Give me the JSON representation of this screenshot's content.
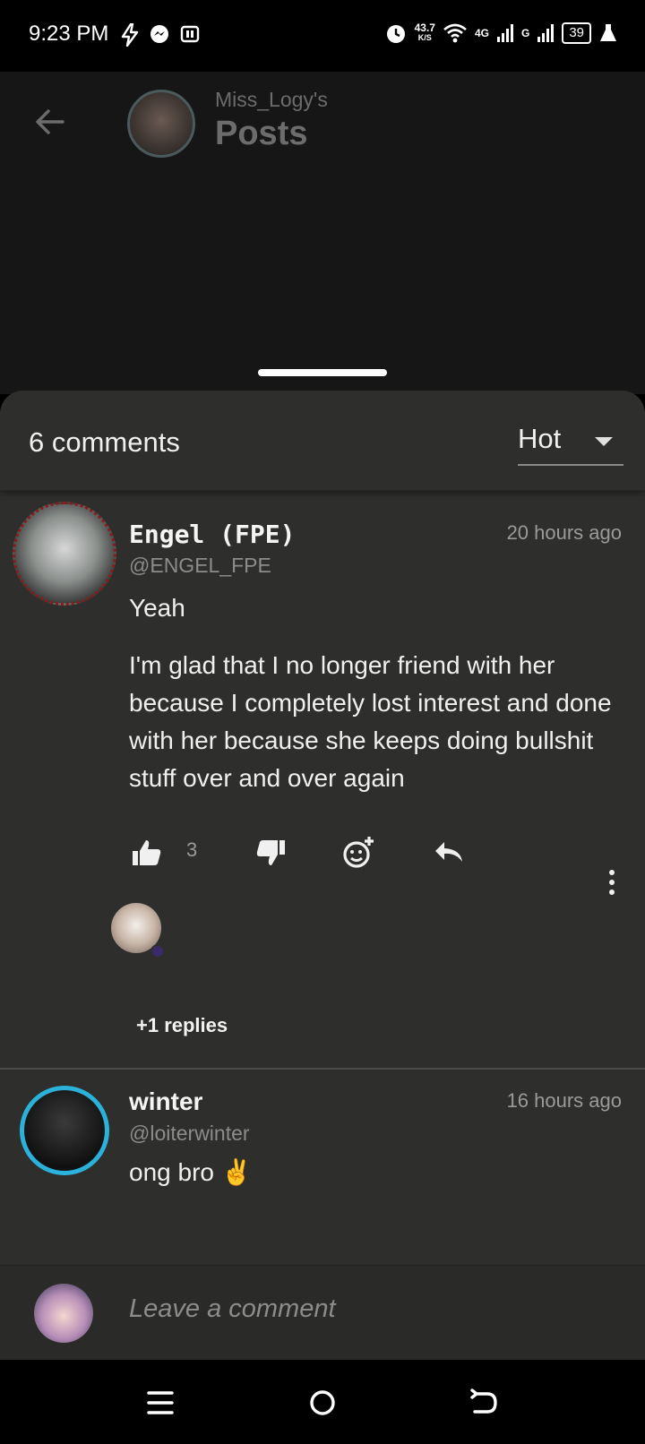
{
  "status_bar": {
    "time": "9:23 PM",
    "net_speed_value": "43.7",
    "net_speed_unit": "K/S",
    "network_4g": "4G",
    "network_g": "G",
    "battery": "39"
  },
  "header": {
    "owner": "Miss_Logy's",
    "title": "Posts"
  },
  "comments_header": {
    "count_label": "6 comments",
    "sort_selected": "Hot"
  },
  "comments": [
    {
      "name": "Engel (FPE)",
      "handle": "@ENGEL_FPE",
      "time": "20 hours ago",
      "text_1": "Yeah",
      "text_2": "I'm glad that I no longer friend with her because I completely lost interest and done with her because she keeps doing bullshit stuff over and over again",
      "likes": "3",
      "replies_label": "+1 replies"
    },
    {
      "name": "winter",
      "handle": "@loiterwinter",
      "time": "16 hours ago",
      "text_1": "ong bro ✌️"
    }
  ],
  "composer": {
    "placeholder": "Leave a comment"
  },
  "colors": {
    "sheet_bg": "#2e2e2c",
    "accent_ring": "#2ab2db",
    "header_text": "#6c6c6c"
  },
  "icons": [
    "back-arrow-icon",
    "thumbs-up-icon",
    "thumbs-down-icon",
    "add-reaction-icon",
    "reply-icon",
    "more-vert-icon",
    "menu-icon",
    "home-circle-icon",
    "back-nav-icon"
  ]
}
